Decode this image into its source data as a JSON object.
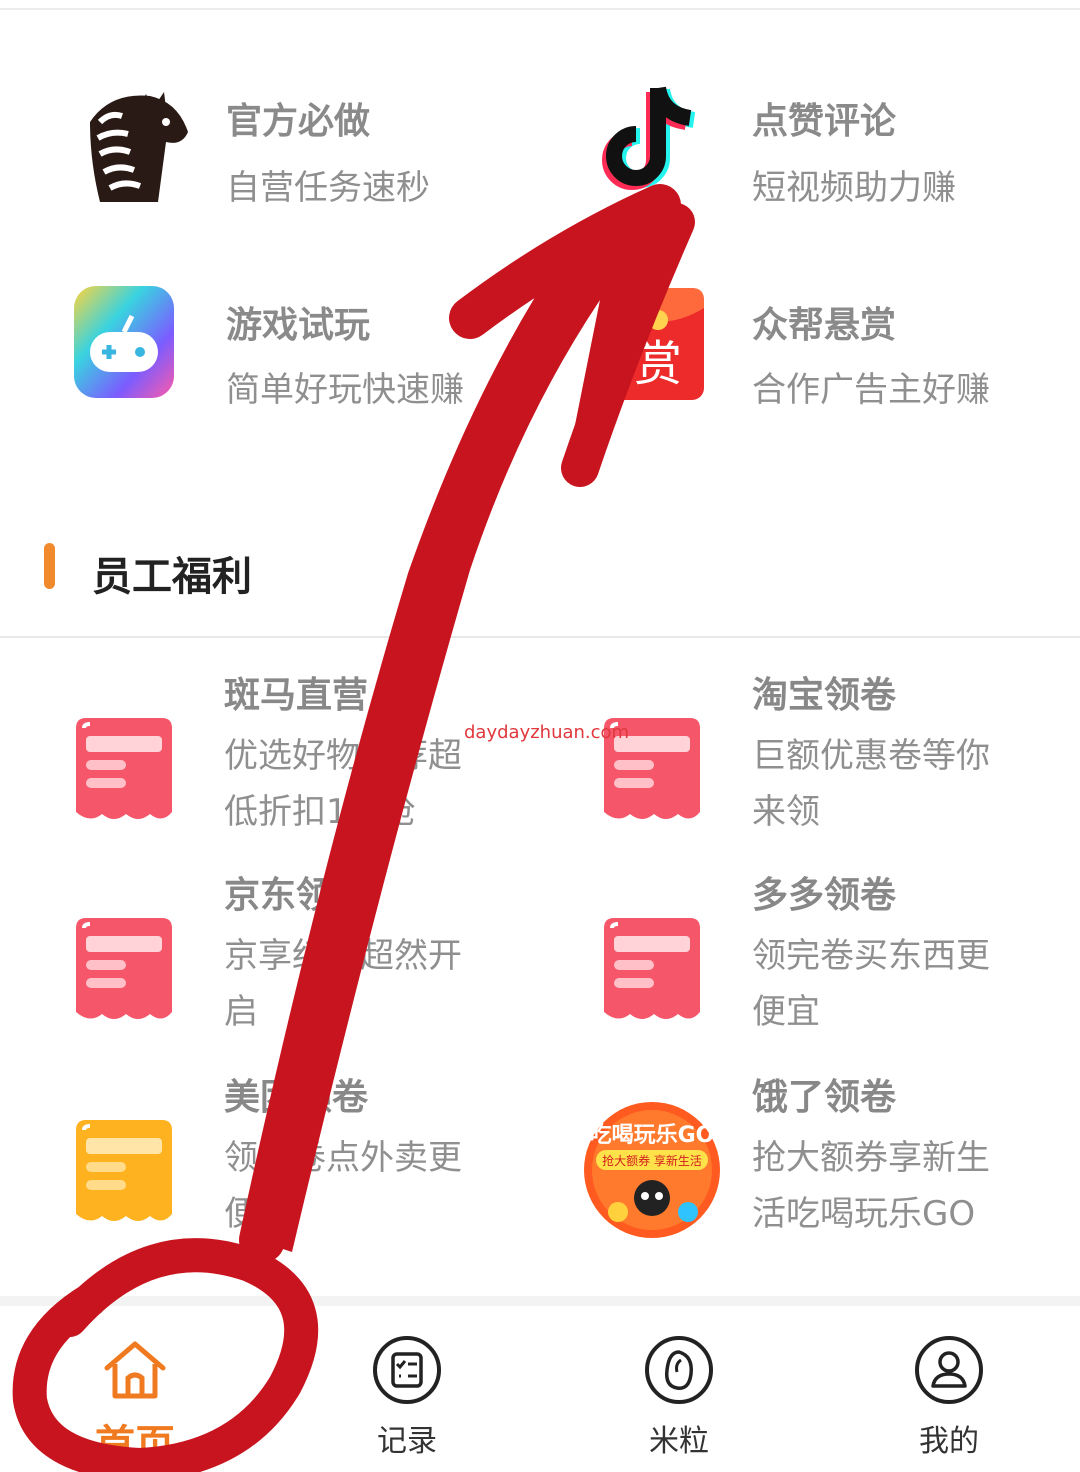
{
  "tasks": [
    {
      "title": "官方必做",
      "subtitle": "自营任务速秒",
      "icon": "zebra-icon"
    },
    {
      "title": "点赞评论",
      "subtitle": "短视频助力赚",
      "icon": "douyin-icon"
    },
    {
      "title": "游戏试玩",
      "subtitle": "简单好玩快速赚",
      "icon": "gamepad-icon"
    },
    {
      "title": "众帮悬赏",
      "subtitle": "合作广告主好赚",
      "icon": "reward-envelope-icon",
      "icon_text": "赏"
    }
  ],
  "section": {
    "title": "员工福利"
  },
  "welfare": [
    {
      "title": "斑马直营",
      "desc": "优选好物推荐超低折扣1元抢",
      "icon": "coupon-icon",
      "color": "#f5566a"
    },
    {
      "title": "淘宝领卷",
      "desc": "巨额优惠卷等你来领",
      "icon": "coupon-icon",
      "color": "#f5566a"
    },
    {
      "title": "京东领卷",
      "desc": "京享红包超然开启",
      "icon": "coupon-icon",
      "color": "#f5566a"
    },
    {
      "title": "多多领卷",
      "desc": "领完卷买东西更便宜",
      "icon": "coupon-icon",
      "color": "#f5566a"
    },
    {
      "title": "美团领卷",
      "desc": "领优卷点外卖更便宜",
      "icon": "coupon-icon",
      "color": "#ffb21f"
    },
    {
      "title": "饿了领卷",
      "desc": "抢大额券享新生活吃喝玩乐GO",
      "icon": "eleme-promo-icon",
      "promo_text": "吃喝玩乐GO",
      "promo_sub": "抢大额券 享新生活"
    }
  ],
  "watermark": "daydayzhuan.com",
  "tabbar": [
    {
      "label": "首页",
      "icon": "home-icon",
      "active": true
    },
    {
      "label": "记录",
      "icon": "record-icon",
      "active": false
    },
    {
      "label": "米粒",
      "icon": "rice-grain-icon",
      "active": false
    },
    {
      "label": "我的",
      "icon": "profile-icon",
      "active": false
    }
  ],
  "colors": {
    "accent": "#f07a20",
    "annotation": "#c8141e",
    "coupon_red": "#f5566a",
    "coupon_yellow": "#ffb21f"
  }
}
